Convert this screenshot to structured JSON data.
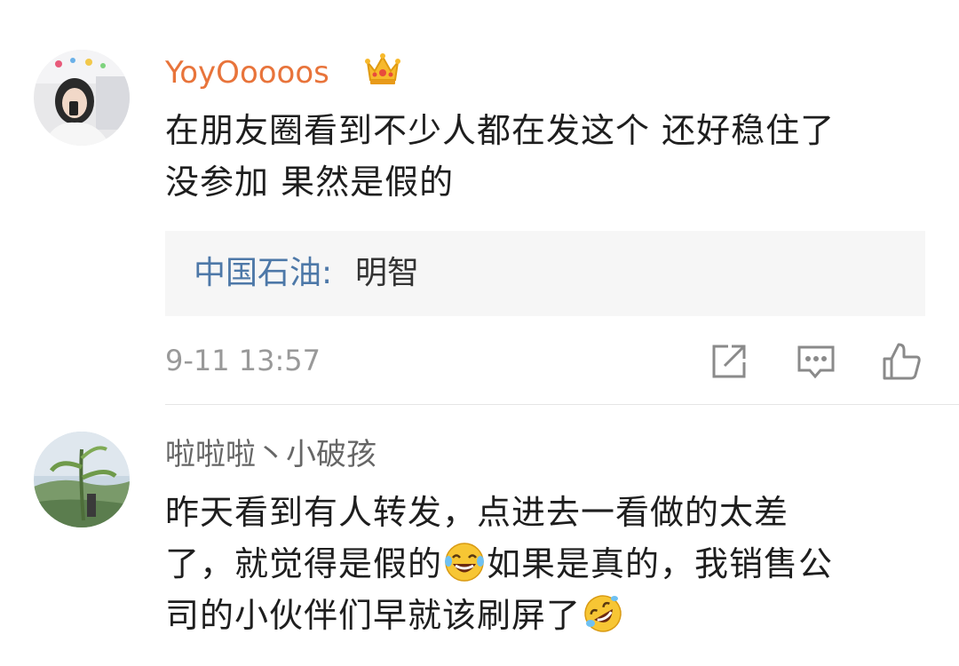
{
  "comments": [
    {
      "username": "YoyOoooos",
      "username_color": "#e8743b",
      "badge_icon": "crown-icon",
      "text_lines": [
        "在朋友圈看到不少人都在发这个  还好稳住了",
        "没参加   果然是假的"
      ],
      "reply_author": "中国石油:",
      "reply_text": "明智",
      "timestamp": "9-11 13:57",
      "actions": [
        "share-icon",
        "comment-icon",
        "like-icon"
      ]
    },
    {
      "username": "啦啦啦丶小破孩",
      "username_color": "#666666",
      "text_line1": "昨天看到有人转发，点进去一看做的太差",
      "text_line2_a": "了，就觉得是假的",
      "text_line2_emoji": "laughing-tears-emoji",
      "text_line2_b": "如果是真的，我销售公",
      "text_line3": "司的小伙伴们早就该刷屏了",
      "text_line3_emoji": "rolling-laugh-emoji"
    }
  ]
}
